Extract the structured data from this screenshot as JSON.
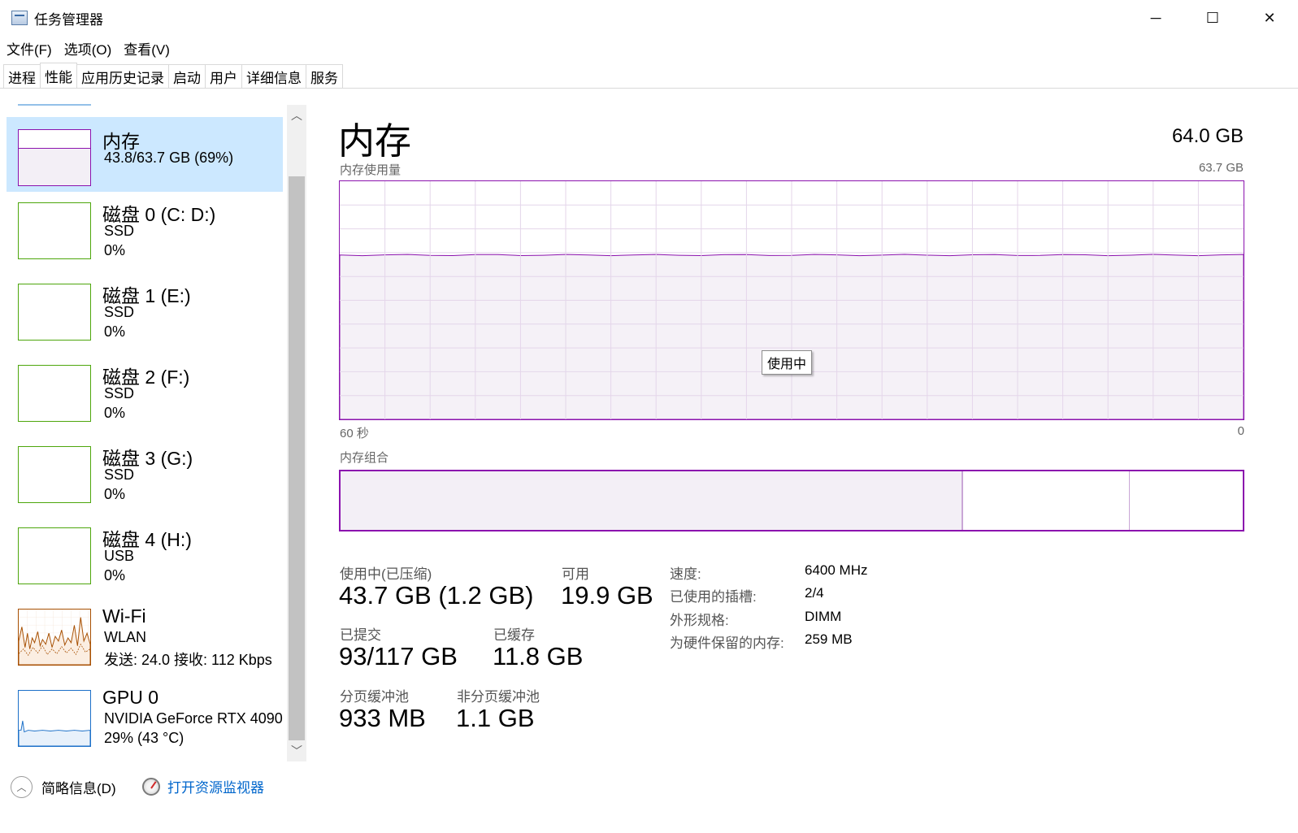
{
  "window": {
    "title": "任务管理器",
    "minimize_glyph": "─",
    "maximize_glyph": "☐",
    "close_glyph": "✕"
  },
  "menu": [
    "文件(F)",
    "选项(O)",
    "查看(V)"
  ],
  "tabs": [
    {
      "label": "进程",
      "active": false
    },
    {
      "label": "性能",
      "active": true
    },
    {
      "label": "应用历史记录",
      "active": false
    },
    {
      "label": "启动",
      "active": false
    },
    {
      "label": "用户",
      "active": false
    },
    {
      "label": "详细信息",
      "active": false
    },
    {
      "label": "服务",
      "active": false
    }
  ],
  "devices": [
    {
      "name": "内存",
      "line1": "43.8/63.7 GB (69%)",
      "line2": "",
      "kind": "memory",
      "selected": true
    },
    {
      "name": "磁盘 0 (C: D:)",
      "line1": "SSD",
      "line2": "0%",
      "kind": "disk"
    },
    {
      "name": "磁盘 1 (E:)",
      "line1": "SSD",
      "line2": "0%",
      "kind": "disk"
    },
    {
      "name": "磁盘 2 (F:)",
      "line1": "SSD",
      "line2": "0%",
      "kind": "disk"
    },
    {
      "name": "磁盘 3 (G:)",
      "line1": "SSD",
      "line2": "0%",
      "kind": "disk"
    },
    {
      "name": "磁盘 4 (H:)",
      "line1": "USB",
      "line2": "0%",
      "kind": "disk"
    },
    {
      "name": "Wi-Fi",
      "line1": "WLAN",
      "line2": "发送: 24.0  接收: 112 Kbps",
      "kind": "wifi"
    },
    {
      "name": "GPU 0",
      "line1": "NVIDIA GeForce RTX 4090",
      "line2": "29% (43 °C)",
      "kind": "gpu"
    }
  ],
  "scroll": {
    "up": "︿",
    "down": "﹀"
  },
  "main": {
    "title": "内存",
    "total": "64.0 GB",
    "graph_label": "内存使用量",
    "graph_max": "63.7 GB",
    "tooltip": "使用中",
    "x_left": "60 秒",
    "x_right": "0",
    "composition_label": "内存组合",
    "usage_fraction": 0.69,
    "composition": {
      "in_use_fraction": 0.69,
      "modified_fraction": 0.185
    },
    "stats": {
      "in_use_label": "使用中(已压缩)",
      "in_use_value": "43.7 GB (1.2 GB)",
      "available_label": "可用",
      "available_value": "19.9 GB",
      "committed_label": "已提交",
      "committed_value": "93/117 GB",
      "cached_label": "已缓存",
      "cached_value": "11.8 GB",
      "paged_label": "分页缓冲池",
      "paged_value": "933 MB",
      "nonpaged_label": "非分页缓冲池",
      "nonpaged_value": "1.1 GB"
    },
    "props": [
      {
        "key": "速度:",
        "value": "6400 MHz"
      },
      {
        "key": "已使用的插槽:",
        "value": "2/4"
      },
      {
        "key": "外形规格:",
        "value": "DIMM"
      },
      {
        "key": "为硬件保留的内存:",
        "value": "259 MB"
      }
    ]
  },
  "footer": {
    "fewer_details": "简略信息(D)",
    "fewer_glyph": "︿",
    "open_resmon": "打开资源监视器"
  },
  "colors": {
    "memory": "#8b12ae",
    "memory_fill": "#f3eff6",
    "disk": "#4da60c",
    "wifi": "#a74f01",
    "gpu": "#1c70c8",
    "selected_bg": "#cce8ff",
    "link": "#0066cc"
  }
}
